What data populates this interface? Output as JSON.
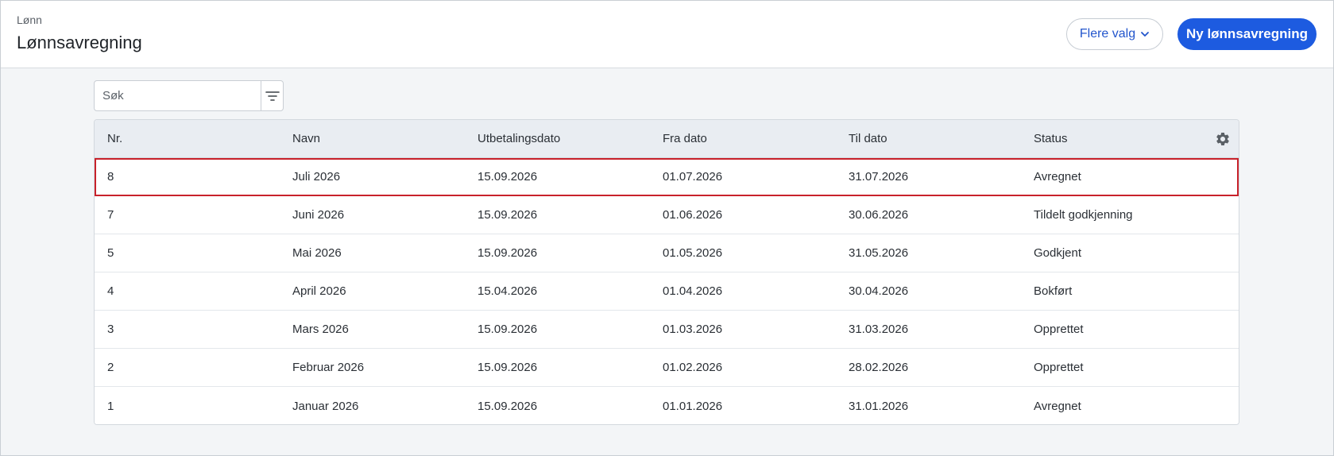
{
  "header": {
    "breadcrumb": "Lønn",
    "title": "Lønnsavregning",
    "more_options_label": "Flere valg",
    "new_button_label": "Ny lønnsavregning"
  },
  "search": {
    "placeholder": "Søk",
    "value": ""
  },
  "table": {
    "columns": [
      "Nr.",
      "Navn",
      "Utbetalingsdato",
      "Fra dato",
      "Til dato",
      "Status"
    ],
    "rows": [
      [
        "8",
        "Juli 2026",
        "15.09.2026",
        "01.07.2026",
        "31.07.2026",
        "Avregnet"
      ],
      [
        "7",
        "Juni 2026",
        "15.09.2026",
        "01.06.2026",
        "30.06.2026",
        "Tildelt godkjenning"
      ],
      [
        "5",
        "Mai 2026",
        "15.09.2026",
        "01.05.2026",
        "31.05.2026",
        "Godkjent"
      ],
      [
        "4",
        "April 2026",
        "15.04.2026",
        "01.04.2026",
        "30.04.2026",
        "Bokført"
      ],
      [
        "3",
        "Mars 2026",
        "15.09.2026",
        "01.03.2026",
        "31.03.2026",
        "Opprettet"
      ],
      [
        "2",
        "Februar 2026",
        "15.09.2026",
        "01.02.2026",
        "28.02.2026",
        "Opprettet"
      ],
      [
        "1",
        "Januar 2026",
        "15.09.2026",
        "01.01.2026",
        "31.01.2026",
        "Avregnet"
      ]
    ]
  },
  "icons": {
    "more_options": "chevron-down-icon",
    "filter": "filter-icon",
    "settings": "gear-icon"
  },
  "colors": {
    "primary": "#1d5be0",
    "link": "#2255cc",
    "selection_border": "#c8222b",
    "header_row_bg": "#e9edf2"
  }
}
